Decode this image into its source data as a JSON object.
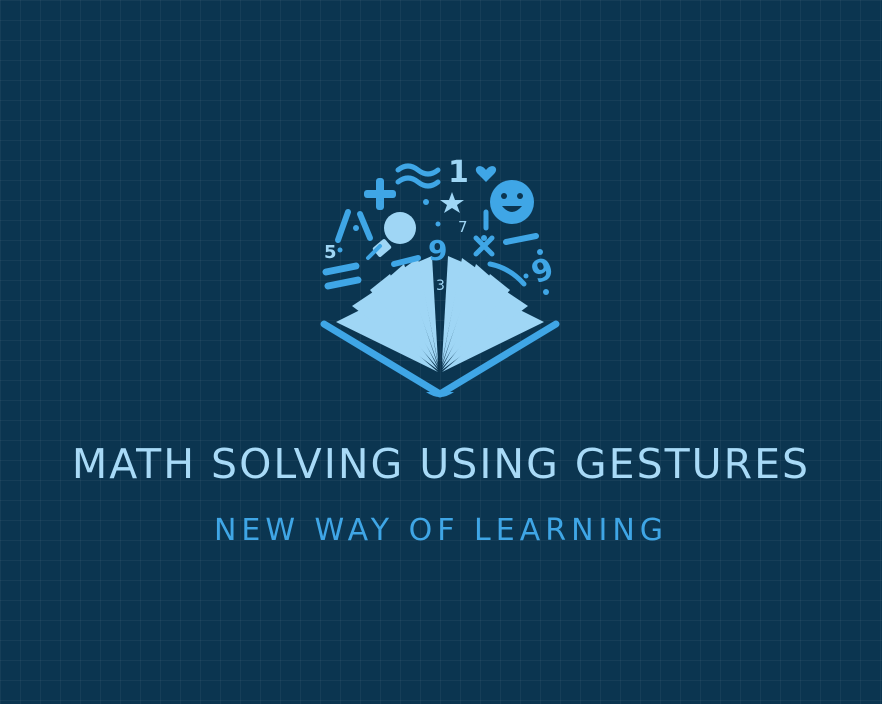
{
  "logo": {
    "icon": "open-book-with-math-symbols-icon",
    "glyphs": {
      "one": "1",
      "five": "5",
      "seven": "7",
      "nine_left": "9",
      "three": "3",
      "nine_right": "9"
    }
  },
  "brand": {
    "title": "MATH SOLVING USING GESTURES",
    "tagline": "NEW WAY OF LEARNING"
  },
  "colors": {
    "background": "#0b3550",
    "title": "#a8daf7",
    "tagline": "#3fa6e6",
    "icon_light": "#9fd6f5",
    "icon_mid": "#3fa6e6"
  }
}
